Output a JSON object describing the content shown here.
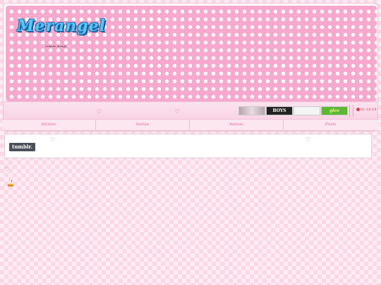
{
  "header": {
    "logo_text": "Merangel",
    "credit_prefix": "website design",
    "credit_by": "by"
  },
  "affiliate_buttons": [
    {
      "label": "",
      "icon": "affiliate-gray-button"
    },
    {
      "label": "BOYS",
      "icon": "affiliate-boys-button"
    },
    {
      "label": "",
      "icon": "affiliate-colorful-button"
    },
    {
      "label": "glee",
      "icon": "affiliate-glee-button"
    }
  ],
  "clock": {
    "time": "01:16:19"
  },
  "nav": {
    "items": [
      {
        "label": "Blinkies"
      },
      {
        "label": "Stamps"
      },
      {
        "label": "Buttons"
      },
      {
        "label": "Pixels"
      }
    ]
  },
  "content": {
    "tumblr_label": "tumblr."
  },
  "colors": {
    "banner_pink": "#f6a9cd",
    "heart": "#e85b9f",
    "link": "#e24f91",
    "logo_fill": "#5ec4f2",
    "logo_outline": "#1a6fb0"
  }
}
